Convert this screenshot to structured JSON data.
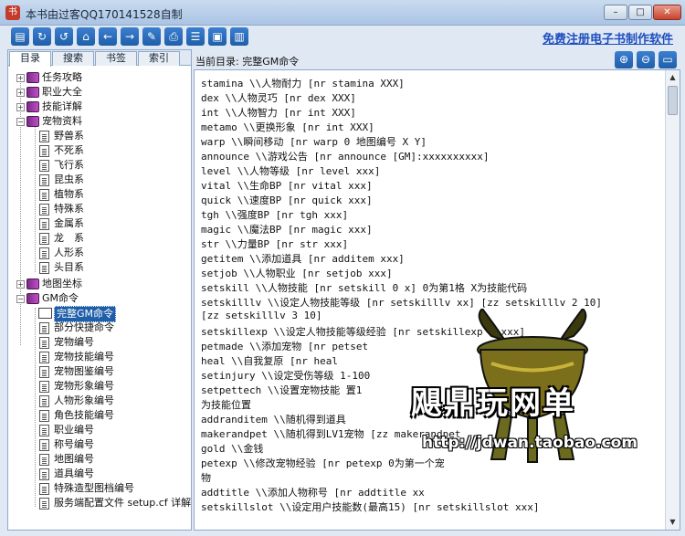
{
  "window": {
    "title": "本书由过客QQ170141528自制"
  },
  "toolbar": {
    "promo_link": "免费注册电子书制作软件"
  },
  "left_tabs": [
    "目录",
    "搜索",
    "书签",
    "索引"
  ],
  "tree": {
    "top": [
      {
        "label": "任务攻略"
      },
      {
        "label": "职业大全"
      },
      {
        "label": "技能详解"
      },
      {
        "label": "宠物资料"
      }
    ],
    "pets": [
      "野兽系",
      "不死系",
      "飞行系",
      "昆虫系",
      "植物系",
      "特殊系",
      "金属系",
      "龙　系",
      "人形系",
      "头目系"
    ],
    "map": "地图坐标",
    "gm": "GM命令",
    "gm_items": [
      "完整GM命令",
      "部分快捷命令",
      "宠物编号",
      "宠物技能编号",
      "宠物图鉴编号",
      "宠物形象编号",
      "人物形象编号",
      "角色技能编号",
      "职业编号",
      "称号编号",
      "地图编号",
      "道具编号",
      "特殊造型图档编号",
      "服务端配置文件 setup.cf 详解"
    ]
  },
  "path": {
    "text": "当前目录: 完整GM命令"
  },
  "lines": [
    "stamina \\\\人物耐力          [nr stamina XXX]",
    "dex \\\\人物灵巧               [nr dex XXX]",
    "int \\\\人物智力               [nr int XXX]",
    "metamo \\\\更换形象          [nr int XXX]",
    "warp \\\\瞬间移动            [nr warp 0 地图编号 X Y]",
    "announce \\\\游戏公告        [nr announce [GM]:xxxxxxxxxx]",
    "level \\\\人物等级             [nr level xxx]",
    "vital \\\\生命BP                              [nr vital xxx]",
    "quick \\\\速度BP                            [nr quick xxx]",
    "tgh \\\\强度BP                                [nr tgh xxx]",
    "magic \\\\魔法BP                          [nr magic xxx]",
    "str \\\\力量BP                                [nr str xxx]",
    "getitem \\\\添加道具          [nr additem xxx]",
    "setjob \\\\人物职业            [nr setjob xxx]",
    "setskill \\\\人物技能          [nr setskill 0 x]     0为第1格 X为技能代码",
    "setskilllv \\\\设定人物技能等级  [nr setskilllv xx]  [zz setskilllv 2 10]",
    "[zz setskilllv 3 10]",
    "setskillexp \\\\设定人物技能等级经验 [nr setskillexp 0 xxx]",
    "petmade \\\\添加宠物              [nr petset",
    "heal \\\\自我复原                        [nr heal",
    "setinjury \\\\设定受伤等级 1-100",
    "setpettech \\\\设置宠物技能                                             置1",
    "为技能位置",
    "addranditem \\\\随机得到道具",
    "makerandpet \\\\随机得到LV1宠物  [zz makerandpet",
    "gold \\\\金钱",
    "petexp \\\\修改宠物经验                   [nr petexp                 0为第一个宠",
    "物",
    "addtitle \\\\添加人物称号                [nr addtitle xx",
    "setskillslot \\\\设定用户技能数(最高15)           [nr setskillslot xxx]"
  ],
  "watermark": {
    "title": "飓鼎玩网单",
    "url": "http://jdwan.taobao.com"
  },
  "colors": {
    "accent": "#1f5fa9",
    "link": "#1f4fbf",
    "frame": "#dfe8f3"
  }
}
